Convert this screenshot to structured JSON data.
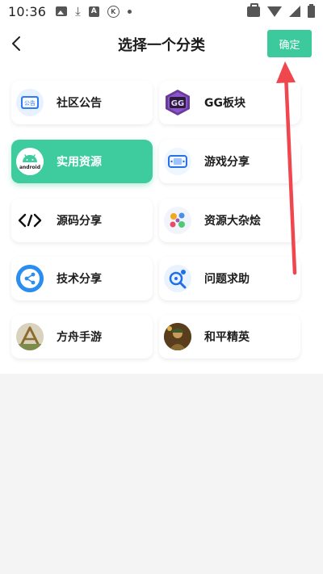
{
  "status_bar": {
    "time": "10:36",
    "k_label": "K",
    "a_label": "A",
    "download_glyph": "⤓"
  },
  "header": {
    "title": "选择一个分类",
    "confirm_label": "确定",
    "back_glyph": "‹"
  },
  "categories": [
    {
      "label": "社区公告",
      "icon": "community-notice-icon",
      "icon_text": "公告",
      "selected": false
    },
    {
      "label": "GG板块",
      "icon": "gg-logo-icon",
      "icon_text": "GG",
      "selected": false
    },
    {
      "label": "实用资源",
      "icon": "android-icon",
      "icon_text": "android",
      "selected": true
    },
    {
      "label": "游戏分享",
      "icon": "game-console-icon",
      "selected": false
    },
    {
      "label": "源码分享",
      "icon": "code-icon",
      "selected": false
    },
    {
      "label": "资源大杂烩",
      "icon": "resource-mix-icon",
      "selected": false
    },
    {
      "label": "技术分享",
      "icon": "share-icon",
      "selected": false
    },
    {
      "label": "问题求助",
      "icon": "help-search-icon",
      "selected": false
    },
    {
      "label": "方舟手游",
      "icon": "ark-game-icon",
      "selected": false
    },
    {
      "label": "和平精英",
      "icon": "peace-elite-game-icon",
      "selected": false
    }
  ],
  "colors": {
    "accent": "#3cc99c",
    "annotation_arrow": "#f0474f",
    "background": "#f4f4f4"
  }
}
